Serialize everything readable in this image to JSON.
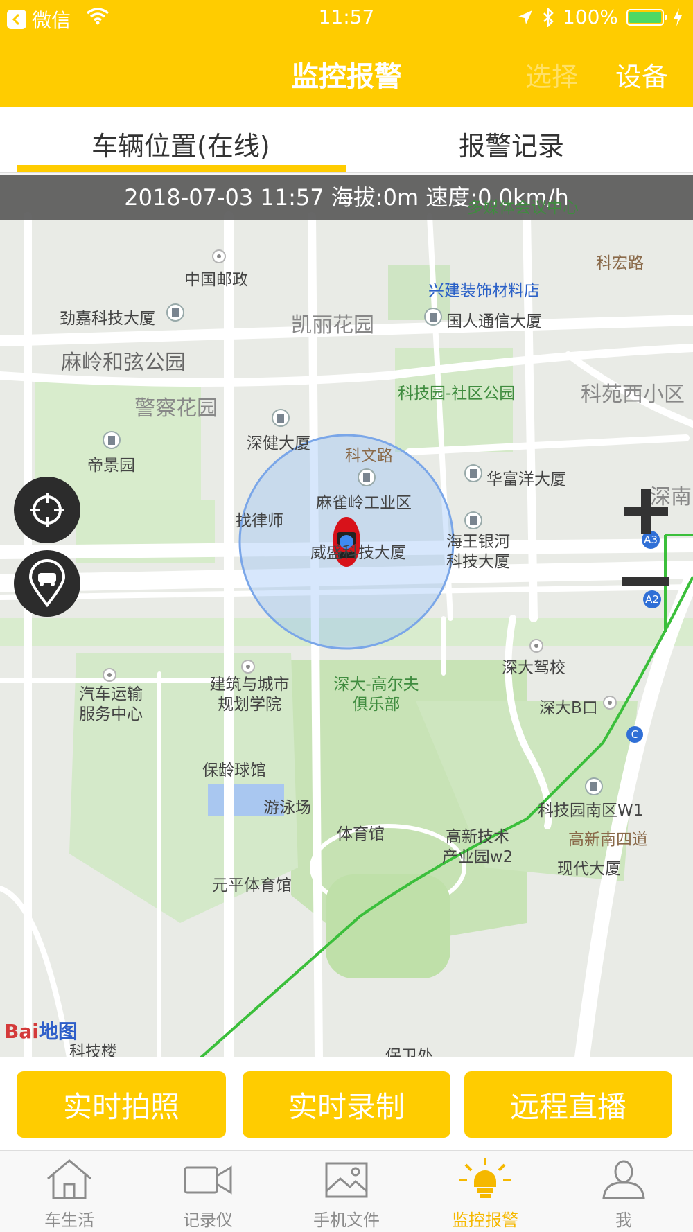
{
  "status_bar": {
    "app": "微信",
    "time": "11:57",
    "battery": "100%",
    "battery_level": 1.0,
    "icons": [
      "back-icon",
      "wifi-icon",
      "location-arrow-icon",
      "bluetooth-icon",
      "battery-icon",
      "charging-icon"
    ]
  },
  "nav": {
    "title": "监控报警",
    "select": "选择",
    "device": "设备"
  },
  "tabs": {
    "vehicle": "车辆位置(在线)",
    "alarm": "报警记录",
    "active": "vehicle"
  },
  "map": {
    "info": "2018-07-03 11:57  海拔:0m  速度:0.0km/h",
    "labels": {
      "multimedia": "多媒体会议中心",
      "kehong_road": "科宏路",
      "china_post": "中国邮政",
      "xingjian": "兴建装饰材料店",
      "jinjia": "劲嘉科技大厦",
      "kaili": "凯丽花园",
      "guoren": "国人通信大厦",
      "maling_park": "麻岭和弦公园",
      "keji_park": "科技园-社区公园",
      "keyuan_xi": "科苑西小区",
      "jingcha": "警察花园",
      "shenjian": "深健大厦",
      "kewen_road": "科文路",
      "dijing": "帝景园",
      "huafu": "华富洋大厦",
      "shennan": "深南",
      "maqueling": "麻雀岭工业区",
      "zhaolvshi": "找律师",
      "weisheng": "威盛科技大厦",
      "haiwang": "海王银河\n科技大厦",
      "a3": "A3",
      "a2": "A2",
      "jianzhu": "建筑与城市\n规划学院",
      "golf": "深大-高尔夫\n俱乐部",
      "driving_school": "深大驾校",
      "qiche": "汽车运输\n服务中心",
      "shenda_b": "深大B口",
      "c_line": "C",
      "bowling": "保龄球馆",
      "pool": "游泳场",
      "kjy_w1": "科技园南区W1",
      "gym": "体育馆",
      "gaoxin_w2": "高新技术\n产业园w2",
      "gaoxin_south4": "高新南四道",
      "xiandai": "现代大厦",
      "yuanping": "元平体育馆",
      "kejilou": "科技楼",
      "baowei": "保卫处"
    },
    "baidu": "Bai地图",
    "controls": [
      "locate-target-icon",
      "vehicle-location-icon",
      "zoom-in-icon",
      "zoom-out-icon"
    ]
  },
  "actions": {
    "photo": "实时拍照",
    "record": "实时录制",
    "live": "远程直播"
  },
  "tabbar": {
    "items": [
      {
        "label": "车生活",
        "icon": "home-icon"
      },
      {
        "label": "记录仪",
        "icon": "video-camera-icon"
      },
      {
        "label": "手机文件",
        "icon": "image-icon"
      },
      {
        "label": "监控报警",
        "icon": "alarm-light-icon"
      },
      {
        "label": "我",
        "icon": "user-icon"
      }
    ],
    "active": "监控报警"
  },
  "colors": {
    "accent": "#ffcc00",
    "active_tab": "#f5b800",
    "battery": "#4cd964",
    "range_circle": "#7aa6e8"
  }
}
